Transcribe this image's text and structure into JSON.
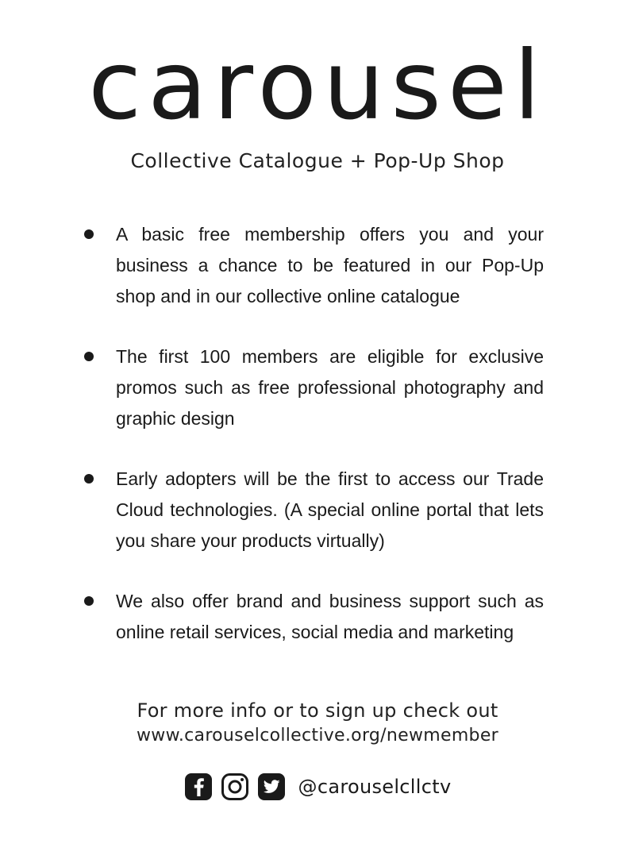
{
  "header": {
    "brand": "carousel",
    "subtitle": "Collective Catalogue + Pop-Up Shop"
  },
  "bullets": [
    {
      "text": "A basic free membership offers you and your business a chance to be featured in our Pop-Up shop and in our collective online catalogue"
    },
    {
      "text": "The first 100 members are eligible for exclusive promos such as free professional photography and graphic design"
    },
    {
      "text": "Early adopters will be the first to access our Trade Cloud technologies. (A special online portal that lets you share your products virtually)"
    },
    {
      "text": "We also offer brand and business support such as online retail services, social media and marketing"
    }
  ],
  "cta": {
    "line": "For more info or to sign up check out",
    "url": "www.carouselcollective.org/newmember"
  },
  "social": {
    "icons": [
      "facebook-icon",
      "instagram-icon",
      "twitter-icon"
    ],
    "handle": "@carouselcllctv"
  }
}
